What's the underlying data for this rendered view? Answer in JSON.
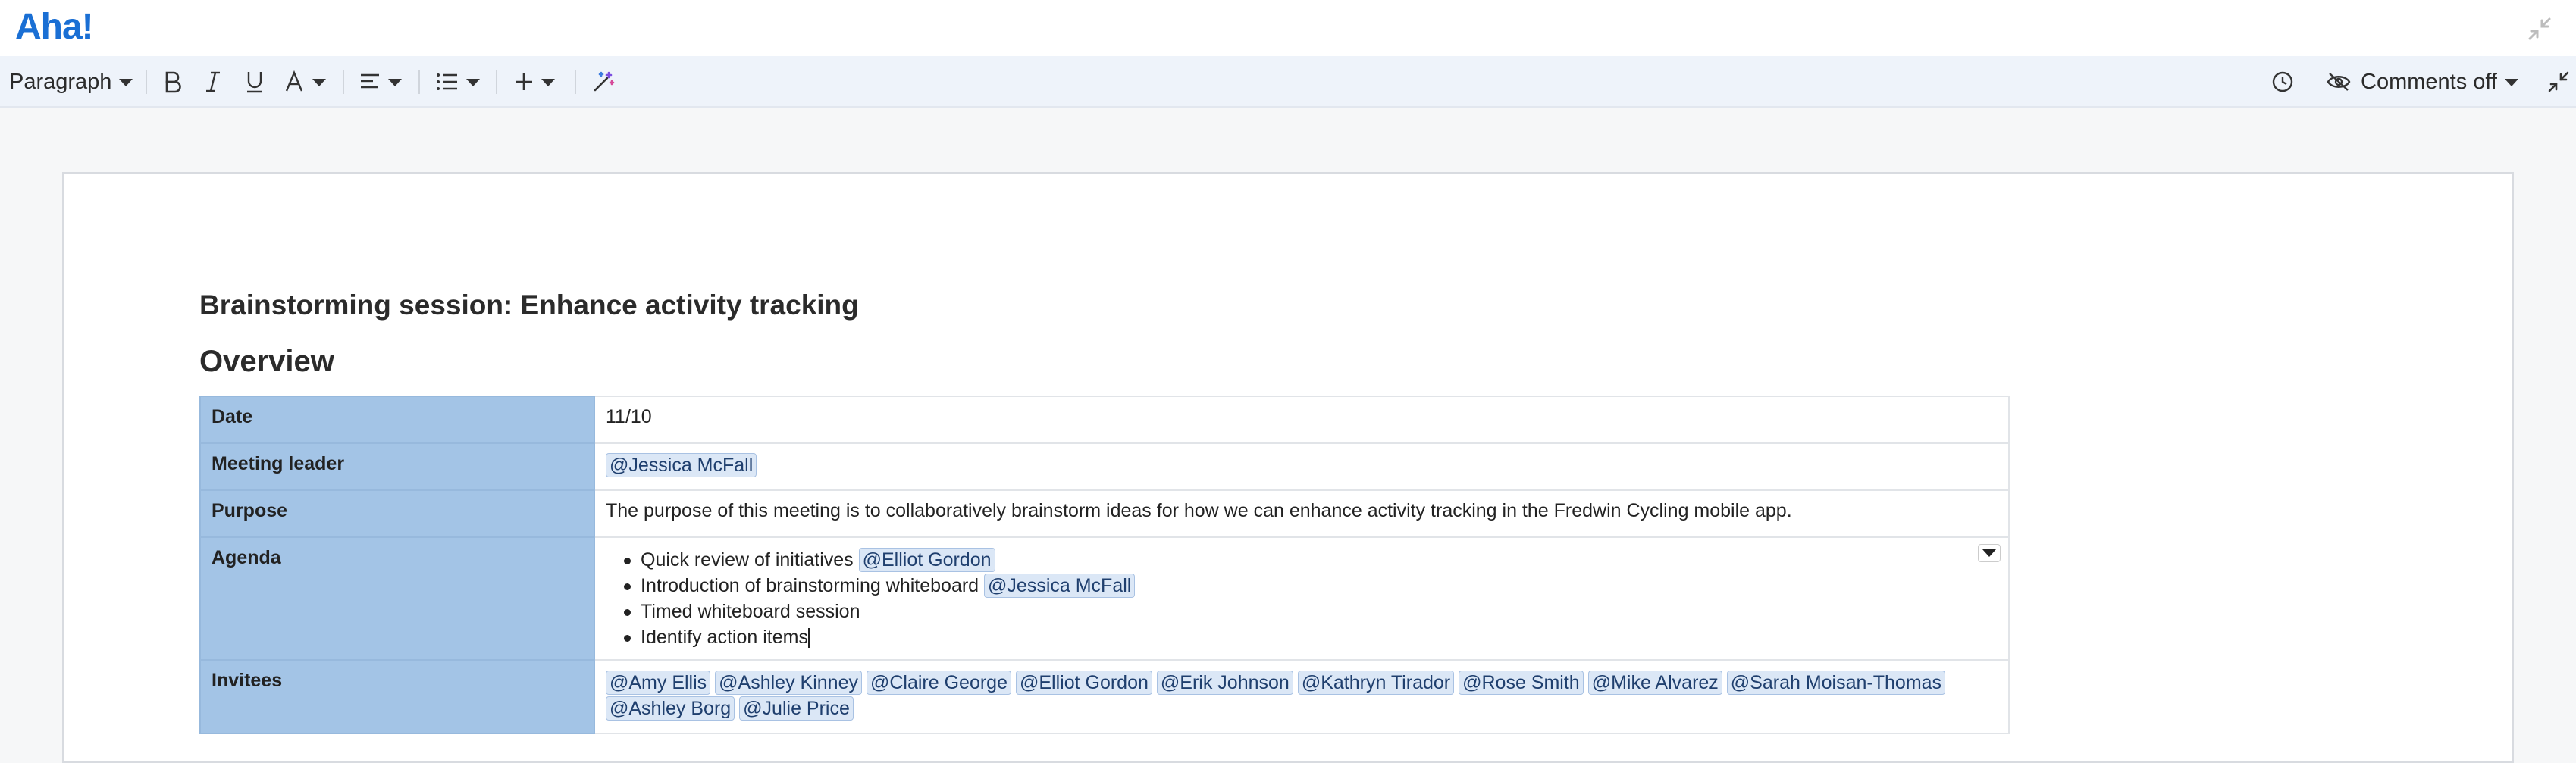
{
  "app": {
    "logo": "Aha!"
  },
  "toolbar": {
    "paragraph_label": "Paragraph",
    "comments_label": "Comments off",
    "icons": [
      "bold-icon",
      "italic-icon",
      "underline-icon",
      "text-color-icon",
      "align-icon",
      "list-icon",
      "plus-icon",
      "magic-wand-icon",
      "history-icon",
      "comments-off-icon",
      "collapse-icon"
    ]
  },
  "document": {
    "title": "Brainstorming session: Enhance activity tracking",
    "overview_heading": "Overview",
    "table": {
      "date_label": "Date",
      "date_value": "11/10",
      "leader_label": "Meeting leader",
      "leader_value": "@Jessica McFall",
      "purpose_label": "Purpose",
      "purpose_value": "The purpose of this meeting is to collaboratively brainstorm ideas for how we can enhance activity tracking in the Fredwin Cycling mobile app.",
      "agenda_label": "Agenda",
      "agenda": [
        {
          "text": "Quick review of initiatives",
          "mention": "@Elliot Gordon"
        },
        {
          "text": "Introduction of brainstorming whiteboard",
          "mention": "@Jessica McFall"
        },
        {
          "text": "Timed whiteboard session",
          "mention": ""
        },
        {
          "text": "Identify action items",
          "mention": ""
        }
      ],
      "invitees_label": "Invitees",
      "invitees": [
        "@Amy Ellis",
        "@Ashley Kinney",
        "@Claire George",
        "@Elliot Gordon",
        "@Erik Johnson",
        "@Kathryn Tirador",
        "@Rose Smith",
        "@Mike Alvarez",
        "@Sarah Moisan-Thomas",
        "@Ashley Borg",
        "@Julie Price"
      ]
    }
  },
  "colors": {
    "brand": "#1a6fd4",
    "table_label_bg": "#a3c4e6",
    "mention_bg": "#dbe7f6",
    "toolbar_bg": "#eef3fa"
  }
}
